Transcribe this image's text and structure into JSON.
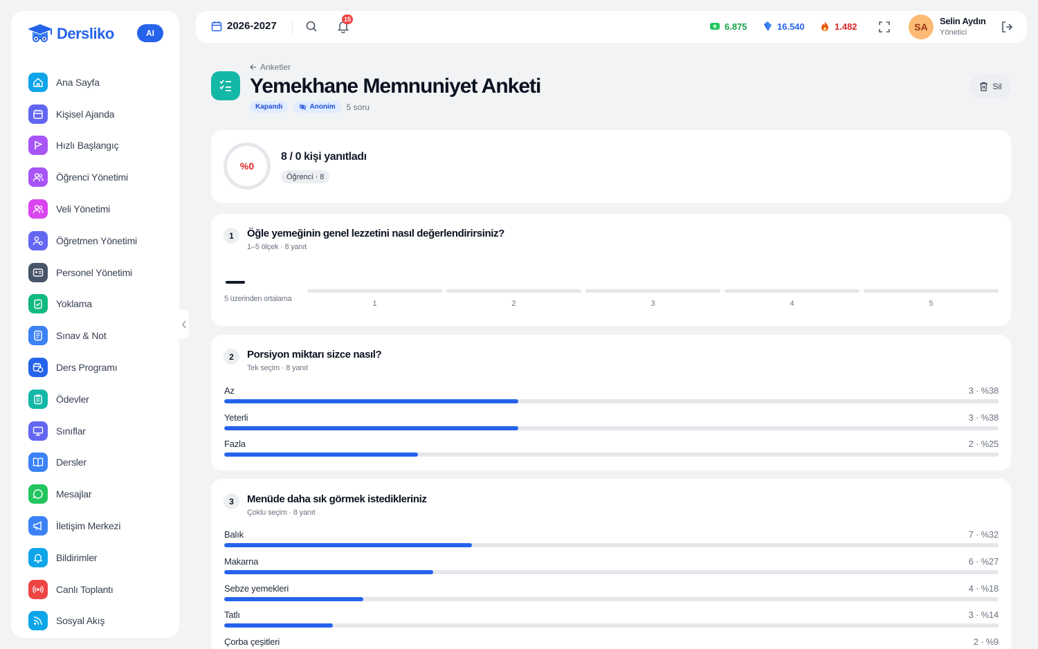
{
  "brand": {
    "name": "Dersliko",
    "ai_label": "AI",
    "color": "#2563eb"
  },
  "sidebar": {
    "items": [
      {
        "label": "Ana Sayfa",
        "icon": "home-icon",
        "color": "#0ea5e9"
      },
      {
        "label": "Kişisel Ajanda",
        "icon": "calendar-icon",
        "color": "#6366f1"
      },
      {
        "label": "Hızlı Başlangıç",
        "icon": "flag-icon",
        "color": "#a855f7"
      },
      {
        "label": "Öğrenci Yönetimi",
        "icon": "users-icon",
        "color": "#a855f7"
      },
      {
        "label": "Veli Yönetimi",
        "icon": "users-icon",
        "color": "#d946ef"
      },
      {
        "label": "Öğretmen Yönetimi",
        "icon": "teacher-icon",
        "color": "#6366f1"
      },
      {
        "label": "Personel Yönetimi",
        "icon": "id-card-icon",
        "color": "#475569"
      },
      {
        "label": "Yoklama",
        "icon": "clipboard-check-icon",
        "color": "#10b981"
      },
      {
        "label": "Sınav & Not",
        "icon": "exam-icon",
        "color": "#3b82f6"
      },
      {
        "label": "Ders Programı",
        "icon": "calendar-clock-icon",
        "color": "#2563eb"
      },
      {
        "label": "Ödevler",
        "icon": "clipboard-icon",
        "color": "#14b8a6"
      },
      {
        "label": "Sınıflar",
        "icon": "presentation-icon",
        "color": "#6366f1"
      },
      {
        "label": "Dersler",
        "icon": "book-icon",
        "color": "#3b82f6"
      },
      {
        "label": "Mesajlar",
        "icon": "message-icon",
        "color": "#22c55e"
      },
      {
        "label": "İletişim Merkezi",
        "icon": "megaphone-icon",
        "color": "#3b82f6"
      },
      {
        "label": "Bildirimler",
        "icon": "bell-icon",
        "color": "#0ea5e9"
      },
      {
        "label": "Canlı Toplantı",
        "icon": "broadcast-icon",
        "color": "#ef4444"
      },
      {
        "label": "Sosyal Akış",
        "icon": "rss-icon",
        "color": "#0ea5e9"
      }
    ]
  },
  "topbar": {
    "year": "2026-2027",
    "notifications": "15",
    "stats": [
      {
        "value": "6.875",
        "icon": "money-icon",
        "color": "#16a34a"
      },
      {
        "value": "16.540",
        "icon": "diamond-icon",
        "color": "#2563eb"
      },
      {
        "value": "1.482",
        "icon": "fire-icon",
        "color": "#dc2626"
      }
    ],
    "user": {
      "initials": "SA",
      "name": "Selin Aydın",
      "role": "Yönetici"
    }
  },
  "header": {
    "back_label": "Anketler",
    "title": "Yemekhane Memnuniyet Anketi",
    "status": "Kapandı",
    "anon": "Anonim",
    "question_count": "5 soru",
    "delete_label": "Sil"
  },
  "summary": {
    "percent": "%0",
    "responded": "8 / 0 kişi yanıtladı",
    "audience": "Öğrenci · 8"
  },
  "questions": [
    {
      "number": "1",
      "title": "Öğle yemeğinin genel lezzetini nasıl değerlendirirsiniz?",
      "meta": "1–5 ölçek · 8 yanıt",
      "average": "—",
      "average_label": "5 üzerinden ortalama",
      "scale": [
        "1",
        "2",
        "3",
        "4",
        "5"
      ]
    },
    {
      "number": "2",
      "title": "Porsiyon miktarı sizce nasıl?",
      "meta": "Tek seçim · 8 yanıt",
      "options": [
        {
          "label": "Az",
          "value": "3 · %38",
          "pct": 38
        },
        {
          "label": "Yeterli",
          "value": "3 · %38",
          "pct": 38
        },
        {
          "label": "Fazla",
          "value": "2 · %25",
          "pct": 25
        }
      ]
    },
    {
      "number": "3",
      "title": "Menüde daha sık görmek istedikleriniz",
      "meta": "Çoklu seçim · 8 yanıt",
      "options": [
        {
          "label": "Balık",
          "value": "7 · %32",
          "pct": 32
        },
        {
          "label": "Makarna",
          "value": "6 · %27",
          "pct": 27
        },
        {
          "label": "Sebze yemekleri",
          "value": "4 · %18",
          "pct": 18
        },
        {
          "label": "Tatlı",
          "value": "3 · %14",
          "pct": 14
        },
        {
          "label": "Çorba çeşitleri",
          "value": "2 · %9",
          "pct": 9
        }
      ]
    }
  ]
}
